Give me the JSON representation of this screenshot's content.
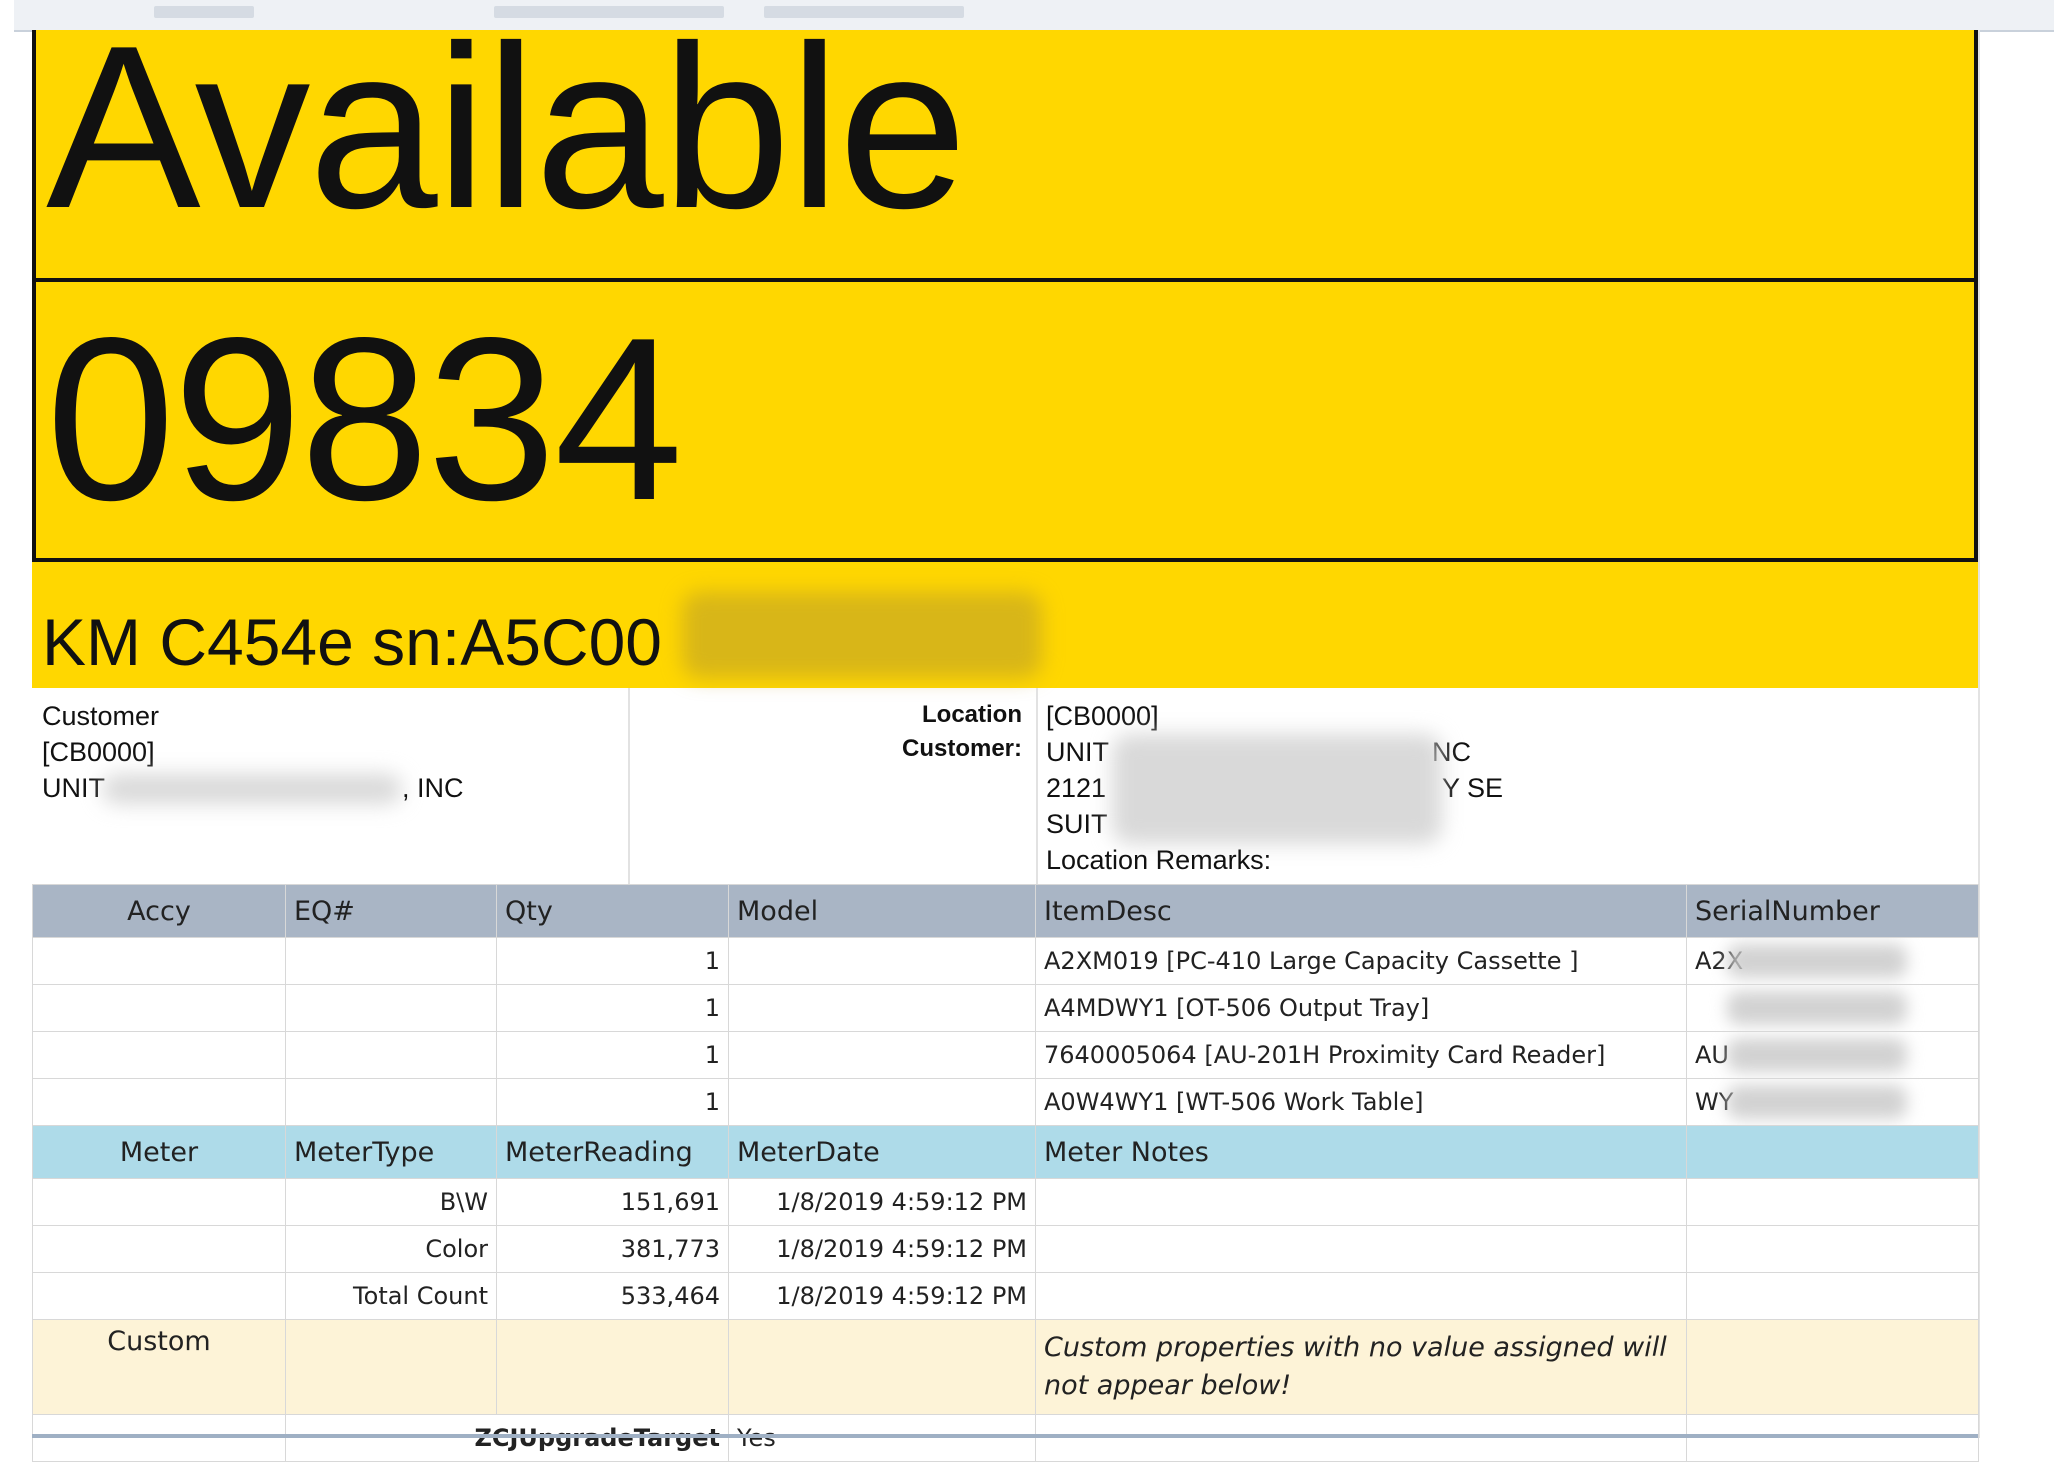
{
  "status": "Available",
  "unit_number": "09834",
  "model_line": "KM C454e sn:A5C00",
  "customer": {
    "label": "Customer",
    "code": "[CB0000]",
    "name_start": "UNIT",
    "name_end": ", INC"
  },
  "location": {
    "label_line1": "Location",
    "label_line2": "Customer:",
    "code": "[CB0000]",
    "name_start": "UNIT",
    "name_end": "NC",
    "address_start": "2121",
    "address_end": "Y SE",
    "suite_start": "SUIT",
    "remarks_label": "Location Remarks:"
  },
  "accessories": {
    "headers": [
      "Accy",
      "EQ#",
      "Qty",
      "Model",
      "ItemDesc",
      "SerialNumber"
    ],
    "rows": [
      {
        "qty": "1",
        "desc": "A2XM019 [PC-410 Large Capacity Cassette ]",
        "serial": "A2X"
      },
      {
        "qty": "1",
        "desc": "A4MDWY1 [OT-506 Output Tray]",
        "serial": ""
      },
      {
        "qty": "1",
        "desc": "7640005064 [AU-201H Proximity Card Reader]",
        "serial": "AU"
      },
      {
        "qty": "1",
        "desc": "A0W4WY1 [WT-506 Work Table]",
        "serial": "WY"
      }
    ]
  },
  "meters": {
    "headers": [
      "Meter",
      "MeterType",
      "MeterReading",
      "MeterDate",
      "Meter Notes"
    ],
    "rows": [
      {
        "type": "B\\W",
        "reading": "151,691",
        "date": "1/8/2019 4:59:12 PM"
      },
      {
        "type": "Color",
        "reading": "381,773",
        "date": "1/8/2019 4:59:12 PM"
      },
      {
        "type": "Total Count",
        "reading": "533,464",
        "date": "1/8/2019 4:59:12 PM"
      }
    ]
  },
  "custom": {
    "header": "Custom",
    "note": "Custom properties with no value assigned will not appear below!",
    "rows": [
      {
        "name": "ZCJUpgradeTarget",
        "value": "Yes"
      }
    ]
  },
  "colors": {
    "banner": "#ffd700",
    "accy_header": "#a9b5c5",
    "meter_header": "#aedbe9",
    "custom_header": "#fdf3d7"
  }
}
